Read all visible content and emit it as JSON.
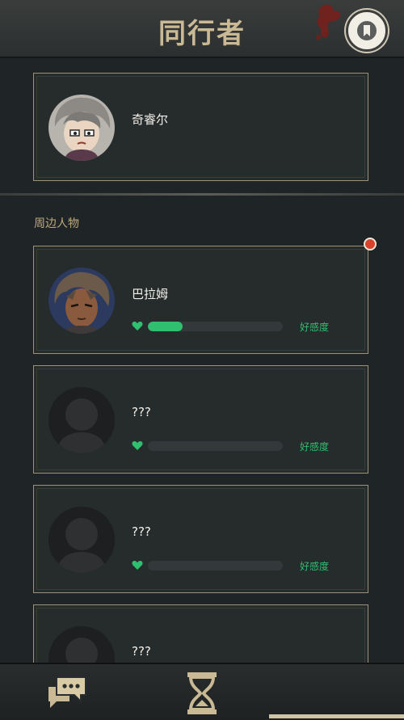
{
  "header": {
    "title": "同行者",
    "bookmark_icon": "bookmark-icon"
  },
  "companion": {
    "name": "奇睿尔",
    "avatar": "boy-gray-hair-avatar"
  },
  "section": {
    "label": "周边人物"
  },
  "nearby": [
    {
      "name": "巴拉姆",
      "affinity_label": "好感度",
      "affinity_fraction": 0.26,
      "avatar": "brown-hair-man-avatar",
      "has_notification": true
    },
    {
      "name": "???",
      "affinity_label": "好感度",
      "affinity_fraction": 0,
      "avatar": "unknown-silhouette-avatar"
    },
    {
      "name": "???",
      "affinity_label": "好感度",
      "affinity_fraction": 0,
      "avatar": "unknown-silhouette-avatar"
    },
    {
      "name": "???",
      "avatar": "unknown-silhouette-avatar"
    }
  ],
  "footer": {
    "icons": [
      "chat-bubbles-icon",
      "hourglass-icon"
    ]
  },
  "colors": {
    "affinity": "#2fbf6e",
    "notification": "#d8412c",
    "title": "#c9b994"
  }
}
